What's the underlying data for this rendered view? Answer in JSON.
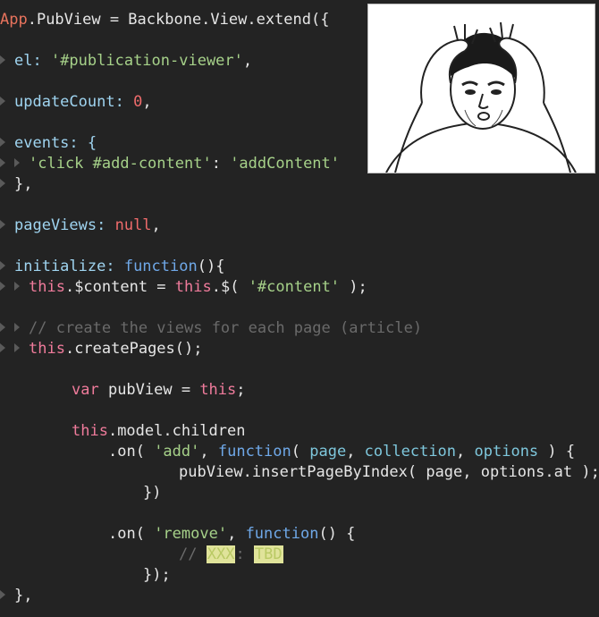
{
  "code": {
    "l1": {
      "a": "App",
      "b": ".PubView = Backbone.View.extend({"
    },
    "l2": {
      "a": "el: ",
      "b": "'#publication-viewer'",
      "c": ","
    },
    "l3": {
      "a": "updateCount: ",
      "b": "0",
      "c": ","
    },
    "l4": {
      "a": "events: {"
    },
    "l5": {
      "a": "'click #add-content'",
      "b": ": ",
      "c": "'addContent'"
    },
    "l6": {
      "a": "},"
    },
    "l7": {
      "a": "pageViews: ",
      "b": "null",
      "c": ","
    },
    "l8": {
      "a": "initialize: ",
      "b": "function",
      "c": "(){"
    },
    "l9": {
      "a": "this",
      "b": ".$content = ",
      "c": "this",
      "d": ".$( ",
      "e": "'#content'",
      "f": " );"
    },
    "l10": {
      "a": "// create the views for each page (article)"
    },
    "l11": {
      "a": "this",
      "b": ".createPages();"
    },
    "l12": {
      "a": "var",
      "b": " pubView = ",
      "c": "this",
      "d": ";"
    },
    "l13": {
      "a": "this",
      "b": ".model.children"
    },
    "l14": {
      "a": ".on( ",
      "b": "'add'",
      "c": ", ",
      "d": "function",
      "e": "( ",
      "f": "page",
      "g": ", ",
      "h": "collection",
      "i": ", ",
      "j": "options",
      "k": " ) {"
    },
    "l15": {
      "a": "pubView.insertPageByIndex( page, options.at );"
    },
    "l16": {
      "a": "})"
    },
    "l17": {
      "a": ".on( ",
      "b": "'remove'",
      "c": ", ",
      "d": "function",
      "e": "() {"
    },
    "l18": {
      "a": "// ",
      "b": "XXX",
      "c": ": ",
      "d": "TBD"
    },
    "l19": {
      "a": "});"
    },
    "l20": {
      "a": "},"
    }
  },
  "meme_image": {
    "icon": "confused-man-meme-image"
  }
}
